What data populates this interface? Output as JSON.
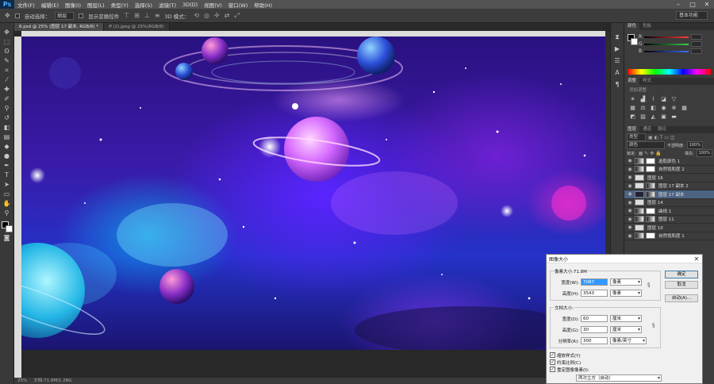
{
  "app": {
    "logo": "Ps"
  },
  "menu": [
    "文件(F)",
    "编辑(E)",
    "图像(I)",
    "图层(L)",
    "类型(Y)",
    "选择(S)",
    "滤镜(T)",
    "3D(D)",
    "视图(V)",
    "窗口(W)",
    "帮助(H)"
  ],
  "window_controls": [
    "–",
    "□",
    "✕"
  ],
  "options": {
    "auto_select_label": "自动选择：",
    "auto_select_value": "图层",
    "show_transform_label": "显示变换控件",
    "mode_3d_label": "3D 模式：",
    "workspace": "基本功能"
  },
  "tabs": [
    {
      "label": "6.psd @ 25% (图层 17 副本, RGB/8) *",
      "active": true
    },
    {
      "label": "ff (2).jpeg @ 25%(RGB/8)",
      "active": false
    }
  ],
  "status": {
    "zoom": "25%",
    "doc": "文档:71.8M/1.28G"
  },
  "panels": {
    "color_tabs": [
      "颜色",
      "色板"
    ],
    "color_channels": [
      {
        "label": "R",
        "color": "#ff3b3b"
      },
      {
        "label": "G",
        "color": "#37d04a"
      },
      {
        "label": "B",
        "color": "#3b6cff"
      }
    ],
    "adjust_tabs": [
      "调整",
      "样式"
    ],
    "adjust_hint": "添加调整",
    "layers_tabs": [
      "图层",
      "通道",
      "路径"
    ],
    "layer_kind": "类型",
    "blend_mode": "颜色",
    "opacity_label": "不透明度:",
    "opacity": "100%",
    "lock_label": "锁定:",
    "fill_label": "填充:",
    "fill": "100%",
    "layers": [
      {
        "name": "选取颜色 1",
        "selected": false
      },
      {
        "name": "自然饱和度 2",
        "selected": false
      },
      {
        "name": "图层 16",
        "selected": false
      },
      {
        "name": "图层 17 副本 2",
        "selected": false
      },
      {
        "name": "图层 17 副本",
        "selected": true
      },
      {
        "name": "图层 14",
        "selected": false
      },
      {
        "name": "曲线 1",
        "selected": false
      },
      {
        "name": "图层 11",
        "selected": false
      },
      {
        "name": "图层 10",
        "selected": false
      },
      {
        "name": "自然饱和度 1",
        "selected": false
      }
    ]
  },
  "dialog": {
    "title": "图像大小",
    "close": "✕",
    "pixel_size": "像素大小:71.8M",
    "px_width_label": "宽度(W):",
    "px_width": "7087",
    "px_width_unit": "像素",
    "px_height_label": "高度(H):",
    "px_height": "3543",
    "px_height_unit": "像素",
    "doc_size": "文档大小:",
    "doc_width_label": "宽度(D):",
    "doc_width": "60",
    "doc_width_unit": "厘米",
    "doc_height_label": "高度(G):",
    "doc_height": "30",
    "doc_height_unit": "厘米",
    "resolution_label": "分辨率(R):",
    "resolution": "300",
    "resolution_unit": "像素/英寸",
    "ok": "确定",
    "cancel": "取消",
    "auto": "自动(A)...",
    "scale_styles": "缩放样式(Y)",
    "constrain": "约束比例(C)",
    "resample": "重定图像像素(I):",
    "resample_method": "两次立方（自动）"
  }
}
